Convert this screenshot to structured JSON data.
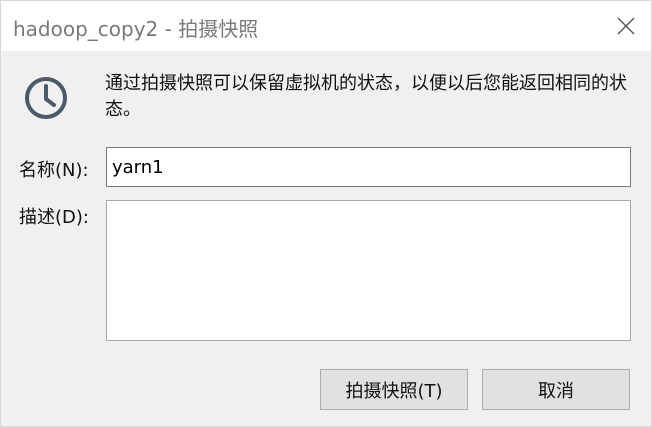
{
  "window": {
    "title": "hadoop_copy2 - 拍摄快照",
    "close_icon": "close-icon"
  },
  "info": {
    "icon": "clock-icon",
    "text": "通过拍摄快照可以保留虚拟机的状态，以便以后您能返回相同的状态。"
  },
  "form": {
    "name_label": "名称(N):",
    "name_value": "yarn1",
    "desc_label": "描述(D):",
    "desc_value": ""
  },
  "buttons": {
    "snapshot_label": "拍摄快照(T)",
    "cancel_label": "取消"
  },
  "colors": {
    "title_text": "#7a7a7a",
    "icon": "#4a5a6a",
    "dialog_bg": "#f0f0f0",
    "button_bg": "#e1e1e1"
  }
}
